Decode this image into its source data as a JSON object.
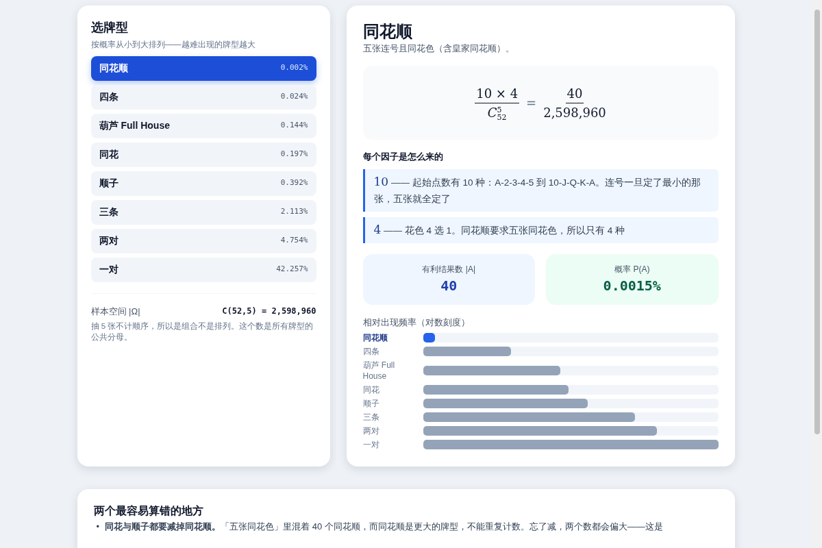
{
  "picker": {
    "title": "选牌型",
    "subtitle": "按概率从小到大排列——越难出现的牌型越大",
    "hands": [
      {
        "name": "同花顺",
        "pct": "0.002%",
        "selected": true
      },
      {
        "name": "四条",
        "pct": "0.024%",
        "selected": false
      },
      {
        "name": "葫芦 Full House",
        "pct": "0.144%",
        "selected": false
      },
      {
        "name": "同花",
        "pct": "0.197%",
        "selected": false
      },
      {
        "name": "顺子",
        "pct": "0.392%",
        "selected": false
      },
      {
        "name": "三条",
        "pct": "2.113%",
        "selected": false
      },
      {
        "name": "两对",
        "pct": "4.754%",
        "selected": false
      },
      {
        "name": "一对",
        "pct": "42.257%",
        "selected": false
      }
    ],
    "sample_label": "样本空间 |Ω|",
    "sample_value": "C(52,5) = 2,598,960",
    "sample_note": "抽 5 张不计顺序，所以是组合不是排列。这个数是所有牌型的公共分母。"
  },
  "detail": {
    "title": "同花顺",
    "description": "五张连号且同花色（含皇家同花顺）。",
    "formula": {
      "left_num": "10 × 4",
      "left_den": "C",
      "left_den_sup": "5",
      "left_den_sub": "52",
      "equals": "=",
      "right_num": "40",
      "right_den": "2,598,960"
    },
    "factors_title": "每个因子是怎么来的",
    "factors": [
      {
        "value": "10",
        "text": "—— 起始点数有 10 种：A-2-3-4-5 到 10-J-Q-K-A。连号一旦定了最小的那张，五张就全定了"
      },
      {
        "value": "4",
        "text": "—— 花色 4 选 1。同花顺要求五张同花色，所以只有 4 种"
      }
    ],
    "stats": [
      {
        "kind": "count",
        "label": "有利结果数 |A|",
        "value": "40"
      },
      {
        "kind": "probability",
        "label": "概率 P(A)",
        "value": "0.0015%"
      }
    ],
    "freq_title": "相对出现频率（对数刻度）",
    "freq": [
      {
        "label": "同花顺",
        "level": 0.04,
        "selected": true
      },
      {
        "label": "四条",
        "level": 0.297,
        "selected": false
      },
      {
        "label": "葫芦 Full House",
        "level": 0.466,
        "selected": false
      },
      {
        "label": "同花",
        "level": 0.494,
        "selected": false
      },
      {
        "label": "顺子",
        "level": 0.559,
        "selected": false
      },
      {
        "label": "三条",
        "level": 0.717,
        "selected": false
      },
      {
        "label": "两对",
        "level": 0.793,
        "selected": false
      },
      {
        "label": "一对",
        "level": 1.0,
        "selected": false
      }
    ]
  },
  "pitfalls": {
    "title": "两个最容易算错的地方",
    "marker": "•",
    "items": [
      "**同花与顺子都要减掉同花顺。**「五张同花色」里混着 40 个同花顺，而同花顺是更大的牌型，不能重复计数。忘了减，两个数都会偏大——这是"
    ]
  }
}
